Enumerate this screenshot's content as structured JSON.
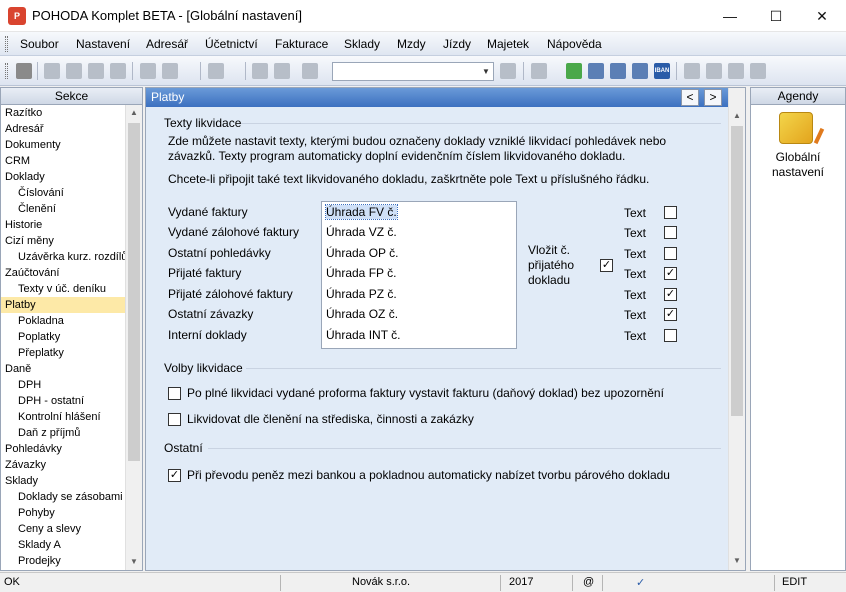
{
  "window": {
    "title": "POHODA Komplet BETA - [Globální nastavení]",
    "icon_text": "P"
  },
  "menu": [
    {
      "label": "Soubor"
    },
    {
      "label": "Nastavení"
    },
    {
      "label": "Adresář"
    },
    {
      "label": "Účetnictví"
    },
    {
      "label": "Fakturace"
    },
    {
      "label": "Sklady"
    },
    {
      "label": "Mzdy"
    },
    {
      "label": "Jízdy"
    },
    {
      "label": "Majetek"
    },
    {
      "label": "Nápověda"
    }
  ],
  "toolbar": {
    "search_value": "",
    "iban_label": "IBAN"
  },
  "sections": {
    "header": "Sekce",
    "items": [
      {
        "label": "Razítko",
        "level": 0
      },
      {
        "label": "Adresář",
        "level": 0
      },
      {
        "label": "Dokumenty",
        "level": 0
      },
      {
        "label": "CRM",
        "level": 0
      },
      {
        "label": "Doklady",
        "level": 0
      },
      {
        "label": "Číslování",
        "level": 1
      },
      {
        "label": "Členění",
        "level": 1
      },
      {
        "label": "Historie",
        "level": 0
      },
      {
        "label": "Cizí měny",
        "level": 0
      },
      {
        "label": "Uzávěrka kurz. rozdílů",
        "level": 1
      },
      {
        "label": "Zaúčtování",
        "level": 0
      },
      {
        "label": "Texty v úč. deníku",
        "level": 1
      },
      {
        "label": "Platby",
        "level": 0,
        "selected": true
      },
      {
        "label": "Pokladna",
        "level": 1
      },
      {
        "label": "Poplatky",
        "level": 1
      },
      {
        "label": "Přeplatky",
        "level": 1
      },
      {
        "label": "Daně",
        "level": 0
      },
      {
        "label": "DPH",
        "level": 1
      },
      {
        "label": "DPH - ostatní",
        "level": 1
      },
      {
        "label": "Kontrolní hlášení",
        "level": 1
      },
      {
        "label": "Daň z příjmů",
        "level": 1
      },
      {
        "label": "Pohledávky",
        "level": 0
      },
      {
        "label": "Závazky",
        "level": 0
      },
      {
        "label": "Sklady",
        "level": 0
      },
      {
        "label": "Doklady se zásobami",
        "level": 1
      },
      {
        "label": "Pohyby",
        "level": 1
      },
      {
        "label": "Ceny a slevy",
        "level": 1
      },
      {
        "label": "Sklady A",
        "level": 1
      },
      {
        "label": "Prodejky",
        "level": 1
      }
    ]
  },
  "main": {
    "header": "Platby",
    "nav_prev": "<",
    "nav_next": ">",
    "group1": {
      "title": "Texty likvidace",
      "desc_line1": "Zde můžete nastavit texty, kterými budou označeny doklady vzniklé likvidací pohledávek nebo",
      "desc_line2": "závazků. Texty program automaticky doplní evidenčním číslem likvidovaného dokladu.",
      "desc_line3": "Chcete-li připojit také text likvidovaného dokladu, zaškrtněte pole Text u příslušného řádku.",
      "rows": [
        {
          "label": "Vydané faktury",
          "text": "Úhrada FV č.",
          "text_label": "Text",
          "checked": false
        },
        {
          "label": "Vydané zálohové faktury",
          "text": "Úhrada VZ č.",
          "text_label": "Text",
          "checked": false
        },
        {
          "label": "Ostatní pohledávky",
          "text": "Úhrada OP č.",
          "text_label": "Text",
          "checked": false
        },
        {
          "label": "Přijaté faktury",
          "text": "Úhrada FP č.",
          "text_label": "Text",
          "checked": true
        },
        {
          "label": "Přijaté zálohové faktury",
          "text": "Úhrada PZ č.",
          "text_label": "Text",
          "checked": true
        },
        {
          "label": "Ostatní závazky",
          "text": "Úhrada OZ č.",
          "text_label": "Text",
          "checked": true
        },
        {
          "label": "Interní doklady",
          "text": "Úhrada INT č.",
          "text_label": "Text",
          "checked": false
        }
      ],
      "insert_line1": "Vložit č.",
      "insert_line2": "přijatého",
      "insert_line3": "dokladu",
      "insert_checked": true
    },
    "group2": {
      "title": "Volby likvidace",
      "opt1": {
        "label": "Po plné likvidaci vydané proforma faktury vystavit fakturu (daňový doklad) bez upozornění",
        "checked": false
      },
      "opt2": {
        "label": "Likvidovat dle členění na střediska, činnosti a zakázky",
        "checked": false
      }
    },
    "group3": {
      "title": "Ostatní",
      "opt1": {
        "label": "Při převodu peněz mezi bankou a pokladnou automaticky nabízet tvorbu párového dokladu",
        "checked": true
      }
    }
  },
  "agendy": {
    "header": "Agendy",
    "item_line1": "Globální",
    "item_line2": "nastavení"
  },
  "status": {
    "left": "OK",
    "company": "Novák s.r.o.",
    "year": "2017",
    "at": "@",
    "mode": "EDIT"
  },
  "colors": {
    "selected_bg": "#fde9a7",
    "header_blue": "#3c70c0",
    "pane_bg": "#e1ebf7"
  }
}
